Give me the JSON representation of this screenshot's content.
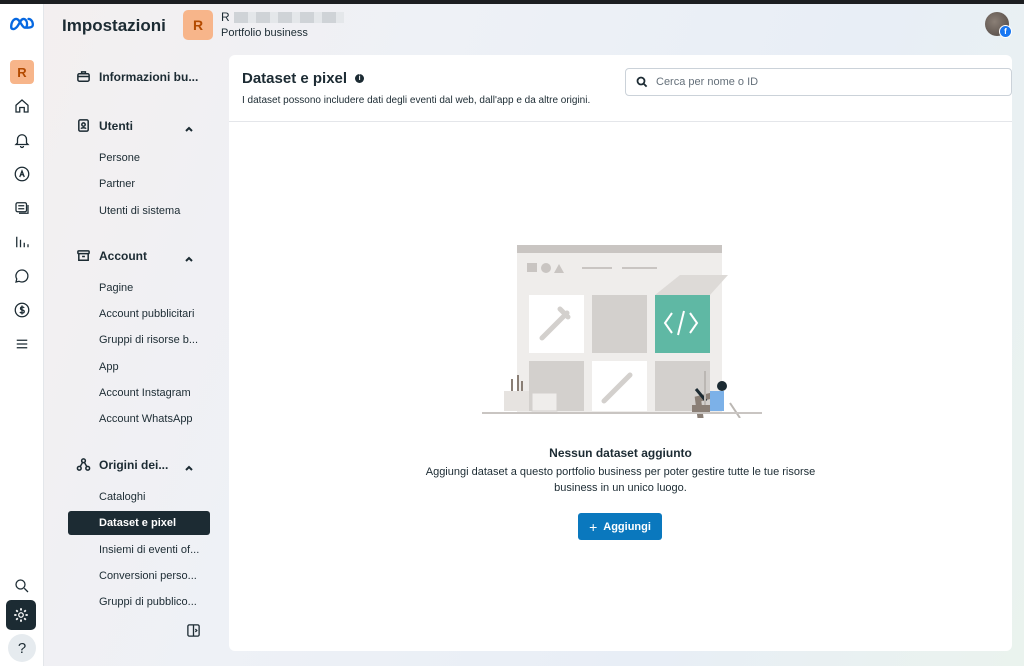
{
  "header": {
    "title": "Impostazioni",
    "business_avatar_letter": "R",
    "business_name_initial": "R",
    "business_subtitle": "Portfolio business"
  },
  "rail": {
    "avatar_letter": "R",
    "help_label": "?"
  },
  "sidebar": {
    "info": "Informazioni bu...",
    "users_group": "Utenti",
    "users_items": [
      "Persone",
      "Partner",
      "Utenti di sistema"
    ],
    "account_group": "Account",
    "account_items": [
      "Pagine",
      "Account pubblicitari",
      "Gruppi di risorse b...",
      "App",
      "Account Instagram",
      "Account WhatsApp"
    ],
    "sources_group": "Origini dei...",
    "sources_items": [
      "Cataloghi",
      "Dataset e pixel",
      "Insiemi di eventi of...",
      "Conversioni perso...",
      "Gruppi di pubblico..."
    ],
    "active_item": "Dataset e pixel"
  },
  "main": {
    "title": "Dataset e pixel",
    "description": "I dataset possono includere dati degli eventi dal web, dall'app e da altre origini.",
    "search_placeholder": "Cerca per nome o ID",
    "empty_title": "Nessun dataset aggiunto",
    "empty_description": "Aggiungi dataset a questo portfolio business per poter gestire tutte le tue risorse business in un unico luogo.",
    "add_button": "Aggiungi",
    "add_button_icon": "+"
  },
  "colors": {
    "primary_button": "#0a78be",
    "active_nav": "#1c2b33",
    "business_avatar": "#f7b58a",
    "illustration_accent": "#5fb8a4"
  }
}
